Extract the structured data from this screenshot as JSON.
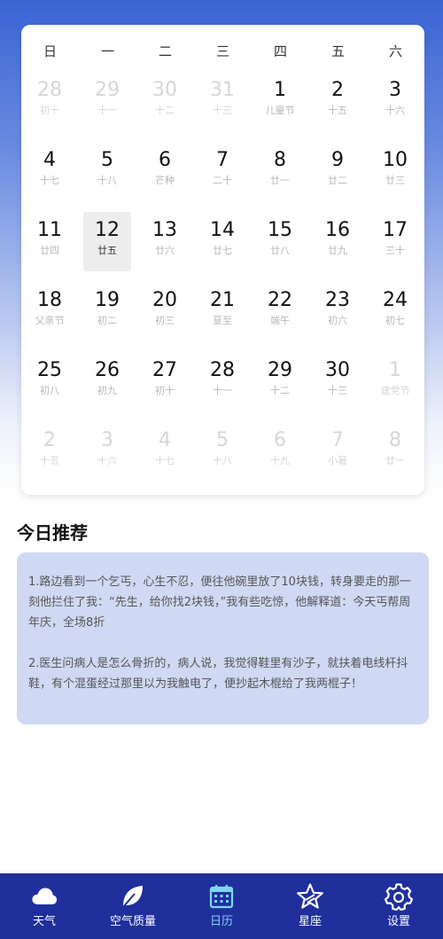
{
  "calendar": {
    "weekdays": [
      "日",
      "一",
      "二",
      "三",
      "四",
      "五",
      "六"
    ],
    "weeks": [
      [
        {
          "d": "28",
          "l": "初十",
          "dim": true
        },
        {
          "d": "29",
          "l": "十一",
          "dim": true
        },
        {
          "d": "30",
          "l": "十二",
          "dim": true
        },
        {
          "d": "31",
          "l": "十三",
          "dim": true
        },
        {
          "d": "1",
          "l": "儿童节"
        },
        {
          "d": "2",
          "l": "十五"
        },
        {
          "d": "3",
          "l": "十六"
        }
      ],
      [
        {
          "d": "4",
          "l": "十七"
        },
        {
          "d": "5",
          "l": "十八"
        },
        {
          "d": "6",
          "l": "芒种"
        },
        {
          "d": "7",
          "l": "二十"
        },
        {
          "d": "8",
          "l": "廿一"
        },
        {
          "d": "9",
          "l": "廿二"
        },
        {
          "d": "10",
          "l": "廿三"
        }
      ],
      [
        {
          "d": "11",
          "l": "廿四"
        },
        {
          "d": "12",
          "l": "廿五",
          "today": true
        },
        {
          "d": "13",
          "l": "廿六"
        },
        {
          "d": "14",
          "l": "廿七"
        },
        {
          "d": "15",
          "l": "廿八"
        },
        {
          "d": "16",
          "l": "廿九"
        },
        {
          "d": "17",
          "l": "三十"
        }
      ],
      [
        {
          "d": "18",
          "l": "父亲节"
        },
        {
          "d": "19",
          "l": "初二"
        },
        {
          "d": "20",
          "l": "初三"
        },
        {
          "d": "21",
          "l": "夏至"
        },
        {
          "d": "22",
          "l": "端午"
        },
        {
          "d": "23",
          "l": "初六"
        },
        {
          "d": "24",
          "l": "初七"
        }
      ],
      [
        {
          "d": "25",
          "l": "初八"
        },
        {
          "d": "26",
          "l": "初九"
        },
        {
          "d": "27",
          "l": "初十"
        },
        {
          "d": "28",
          "l": "十一"
        },
        {
          "d": "29",
          "l": "十二"
        },
        {
          "d": "30",
          "l": "十三"
        },
        {
          "d": "1",
          "l": "建党节",
          "dim": true
        }
      ],
      [
        {
          "d": "2",
          "l": "十五",
          "dim": true
        },
        {
          "d": "3",
          "l": "十六",
          "dim": true
        },
        {
          "d": "4",
          "l": "十七",
          "dim": true
        },
        {
          "d": "5",
          "l": "十八",
          "dim": true
        },
        {
          "d": "6",
          "l": "十九",
          "dim": true
        },
        {
          "d": "7",
          "l": "小暑",
          "dim": true
        },
        {
          "d": "8",
          "l": "廿一",
          "dim": true
        }
      ]
    ]
  },
  "recommend": {
    "title": "今日推荐",
    "jokes": [
      "1.路边看到一个乞丐，心生不忍，便往他碗里放了10块钱，转身要走的那一刻他拦住了我：“先生，给你找2块钱，”我有些吃惊，他解释道：今天丐帮周年庆，全场8折",
      "2.医生问病人是怎么骨折的，病人说，我觉得鞋里有沙子，就扶着电线杆抖鞋，有个混蛋经过那里以为我触电了，便抄起木棍给了我两棍子！"
    ]
  },
  "nav": {
    "items": [
      {
        "label": "天气",
        "icon": "cloud-icon"
      },
      {
        "label": "空气质量",
        "icon": "leaf-icon"
      },
      {
        "label": "日历",
        "icon": "calendar-icon",
        "active": true
      },
      {
        "label": "星座",
        "icon": "star-icon"
      },
      {
        "label": "设置",
        "icon": "gear-icon"
      }
    ],
    "colors": {
      "bar": "#1f2f9c",
      "active": "#7fd6f2",
      "inactive": "#ffffff"
    }
  }
}
